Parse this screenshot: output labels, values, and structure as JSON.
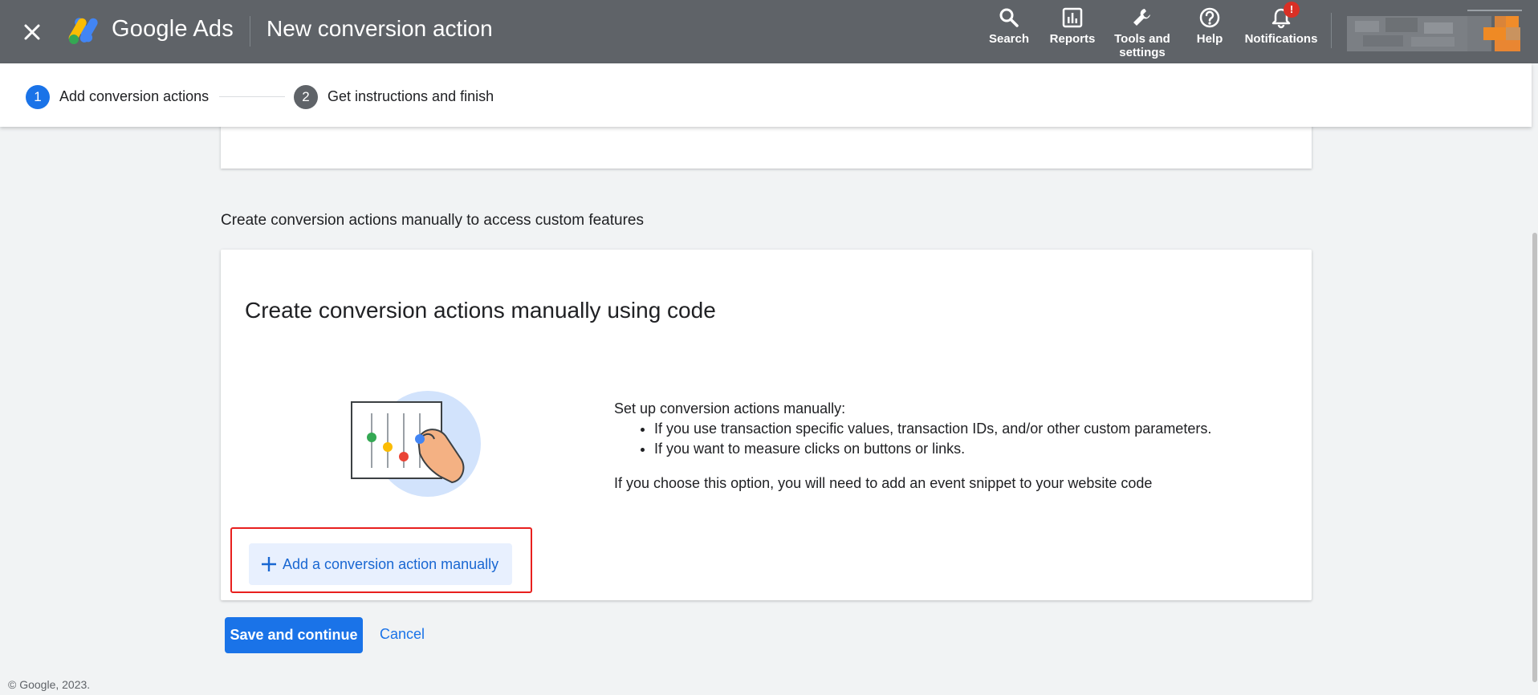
{
  "header": {
    "product_name": "Google Ads",
    "page_title": "New conversion action",
    "close_icon": "close-icon",
    "nav": [
      {
        "label": "Search",
        "icon": "search-icon"
      },
      {
        "label": "Reports",
        "icon": "reports-icon"
      },
      {
        "label_line1": "Tools and",
        "label_line2": "settings",
        "icon": "wrench-icon"
      },
      {
        "label": "Help",
        "icon": "help-icon"
      },
      {
        "label": "Notifications",
        "icon": "bell-icon",
        "badge": "!"
      }
    ]
  },
  "stepper": {
    "steps": [
      {
        "number": "1",
        "label": "Add conversion actions",
        "color": "#1a73e8"
      },
      {
        "number": "2",
        "label": "Get instructions and finish",
        "color": "#5f6368"
      }
    ]
  },
  "section": {
    "heading": "Create conversion actions manually to access custom features"
  },
  "card": {
    "title": "Create conversion actions manually using code",
    "intro": "Set up conversion actions manually:",
    "bullets": [
      "If you use transaction specific values, transaction IDs, and/or other custom parameters.",
      "If you want to measure clicks on buttons or links."
    ],
    "note": "If you choose this option, you will need to add an event snippet to your website code",
    "add_button_label": "Add a conversion action manually"
  },
  "actions": {
    "save_label": "Save and continue",
    "cancel_label": "Cancel"
  },
  "footer": {
    "copyright": "© Google, 2023."
  },
  "colors": {
    "header_bg": "#5f6368",
    "primary": "#1a73e8",
    "highlight": "#e8201e",
    "page_bg": "#f1f3f4"
  }
}
